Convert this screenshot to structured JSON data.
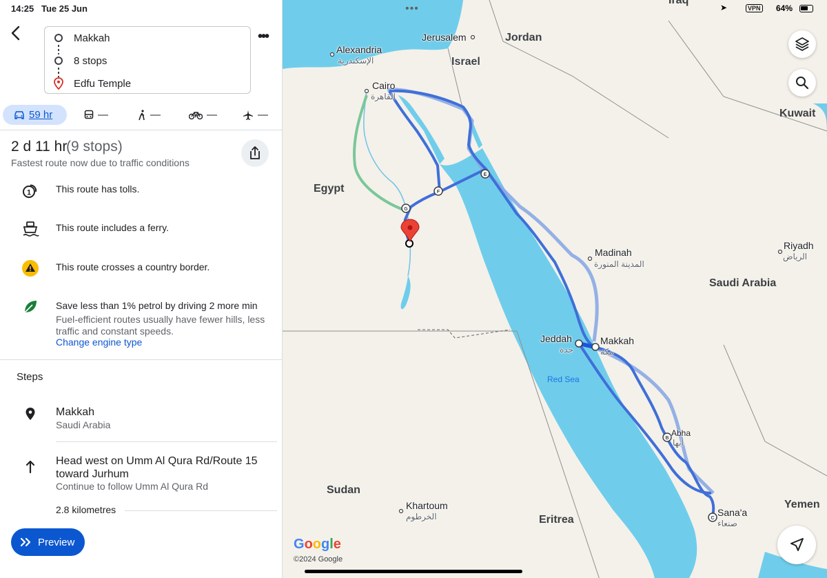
{
  "status": {
    "time": "14:25",
    "date": "Tue 25 Jun",
    "vpn": "VPN",
    "battery": "64%",
    "battery_level": 0.64
  },
  "route": {
    "origin": "Makkah",
    "stops": "8 stops",
    "destination": "Edfu Temple"
  },
  "modes": [
    {
      "name": "car-icon",
      "label": "59 hr",
      "active": true
    },
    {
      "name": "transit-icon",
      "label": "—"
    },
    {
      "name": "walk-icon",
      "label": "—"
    },
    {
      "name": "bike-icon",
      "label": "—"
    },
    {
      "name": "flight-icon",
      "label": "—"
    }
  ],
  "summary": {
    "duration": "2 d 11 hr",
    "stops": "(9 stops)",
    "note": "Fastest route now due to traffic conditions"
  },
  "notices": [
    {
      "icon": "toll-icon",
      "text": "This route has tolls."
    },
    {
      "icon": "ferry-icon",
      "text": "This route includes a ferry."
    },
    {
      "icon": "warning-icon",
      "text": "This route crosses a country border."
    },
    {
      "icon": "leaf-icon",
      "text": "Save less than 1% petrol by driving 2 more min",
      "sub": "Fuel-efficient routes usually have fewer hills, less traffic and constant speeds.",
      "link": "Change engine type"
    }
  ],
  "steps": {
    "heading": "Steps",
    "items": [
      {
        "icon": "location-pin-icon",
        "title": "Makkah",
        "sub": "Saudi Arabia"
      },
      {
        "icon": "arrow-up-icon",
        "title": "Head west on Umm Al Qura Rd/Route 15 toward Jurhum",
        "sub": "Continue to follow Umm Al Qura Rd",
        "distance": "2.8 kilometres"
      }
    ]
  },
  "preview_label": "Preview",
  "map": {
    "labels": {
      "alexandria": "Alexandria",
      "alexandria_ar": "الإسكندرية",
      "jerusalem": "Jerusalem",
      "jordan": "Jordan",
      "israel": "Israel",
      "iraq": "Iraq",
      "kuwait": "Kuwait",
      "cairo": "Cairo",
      "cairo_ar": "القاهرة",
      "egypt": "Egypt",
      "madinah": "Madinah",
      "madinah_ar": "المدينة المنورة",
      "riyadh": "Riyadh",
      "riyadh_ar": "الرياض",
      "saudi_arabia": "Saudi Arabia",
      "jeddah": "Jeddah",
      "jeddah_ar": "جدة",
      "makkah": "Makkah",
      "makkah_ar": "مكة",
      "red_sea": "Red Sea",
      "abha": "Abha",
      "abha_ar": "أبها",
      "sudan": "Sudan",
      "khartoum": "Khartoum",
      "khartoum_ar": "الخرطوم",
      "eritrea": "Eritrea",
      "sanaa": "Sana'a",
      "sanaa_ar": "صنعاء",
      "yemen": "Yemen"
    },
    "logo": "Google",
    "copyright": "©2024 Google",
    "colors": {
      "water": "#6fcdeb",
      "route": "#4e7fe0",
      "route_alt": "#8aa8e6",
      "route_main": "#1a56db",
      "land": "#f4f1ea",
      "pin": "#ea4335"
    }
  }
}
